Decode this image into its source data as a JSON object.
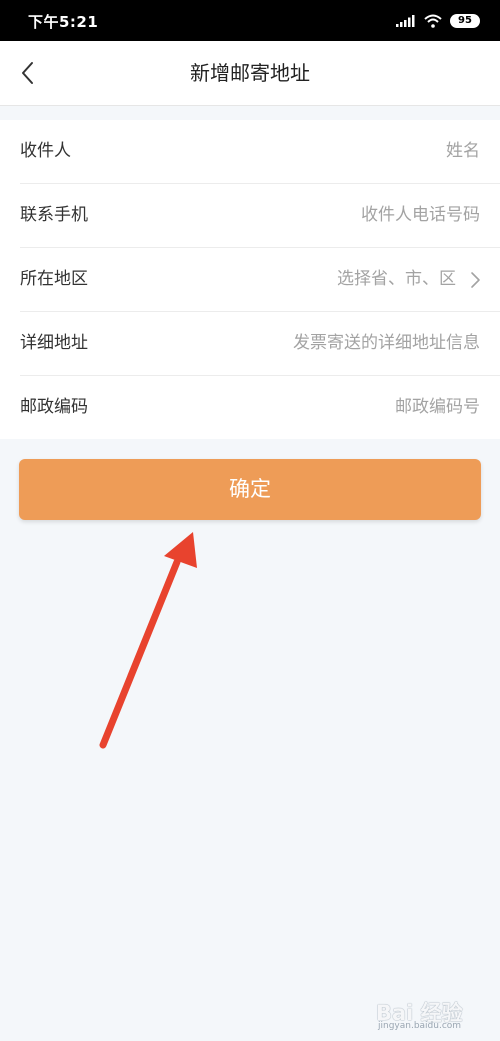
{
  "status": {
    "time": "下午5:21",
    "battery": "95"
  },
  "header": {
    "title": "新增邮寄地址",
    "back_icon": "chevron-left-icon"
  },
  "form": {
    "rows": [
      {
        "label": "收件人",
        "placeholder": "姓名"
      },
      {
        "label": "联系手机",
        "placeholder": "收件人电话号码"
      },
      {
        "label": "所在地区",
        "placeholder": "选择省、市、区"
      },
      {
        "label": "详细地址",
        "placeholder": "发票寄送的详细地址信息"
      },
      {
        "label": "邮政编码",
        "placeholder": "邮政编码号"
      }
    ]
  },
  "confirm_label": "确定",
  "colors": {
    "accent": "#ee9c57",
    "arrow": "#e8432e",
    "background": "#f4f7fa"
  },
  "watermark": {
    "text": "Bai 经验",
    "sub": "jingyan.baidu.com"
  }
}
